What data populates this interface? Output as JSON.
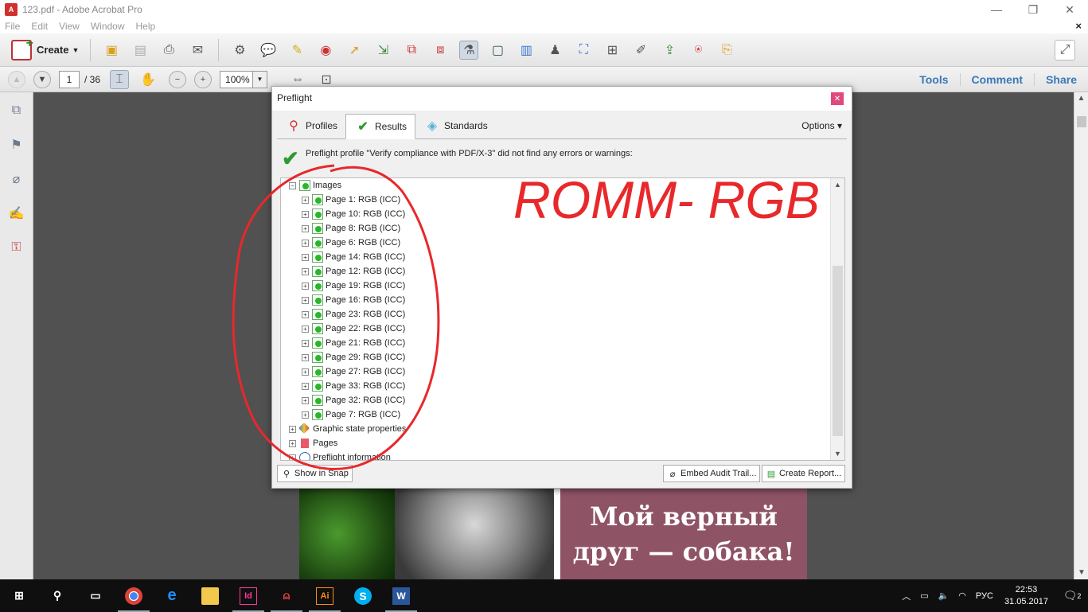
{
  "window": {
    "title": "123.pdf - Adobe Acrobat Pro",
    "minimize": "—",
    "restore": "❐",
    "close": "✕"
  },
  "menu": {
    "items": [
      "File",
      "Edit",
      "View",
      "Window",
      "Help"
    ],
    "close_doc": "×"
  },
  "toolbar": {
    "create_label": "Create"
  },
  "navbar": {
    "page_current": "1",
    "page_total": "/ 36",
    "zoom": "100%",
    "links": [
      "Tools",
      "Comment",
      "Share"
    ]
  },
  "preflight": {
    "title": "Preflight",
    "tabs": [
      "Profiles",
      "Results",
      "Standards"
    ],
    "active_tab": "Results",
    "options_label": "Options",
    "message": "Preflight profile \"Verify compliance with PDF/X-3\" did not find any errors or warnings:",
    "tree": {
      "root": "Images",
      "pages": [
        "Page 1: RGB (ICC)",
        "Page 10: RGB (ICC)",
        "Page 8: RGB (ICC)",
        "Page 6: RGB (ICC)",
        "Page 14: RGB (ICC)",
        "Page 12: RGB (ICC)",
        "Page 19: RGB (ICC)",
        "Page 16: RGB (ICC)",
        "Page 23: RGB (ICC)",
        "Page 22: RGB (ICC)",
        "Page 21: RGB (ICC)",
        "Page 29: RGB (ICC)",
        "Page 27: RGB (ICC)",
        "Page 33: RGB (ICC)",
        "Page 32: RGB (ICC)",
        "Page 7: RGB (ICC)"
      ],
      "graphic_state": "Graphic state properties",
      "pages_node": "Pages",
      "preflight_info": "Preflight information"
    },
    "buttons": {
      "show_in_snap": "Show in Snap",
      "embed_audit": "Embed Audit Trail...",
      "create_report": "Create Report..."
    }
  },
  "document": {
    "text_line1": "Мой верный",
    "text_line2": "друг — собака!"
  },
  "annotation": {
    "handwriting": "ROMM- RGB",
    "color": "#e8282b"
  },
  "taskbar": {
    "language": "РУС",
    "time": "22:53",
    "date": "31.05.2017",
    "notifications": "2"
  }
}
